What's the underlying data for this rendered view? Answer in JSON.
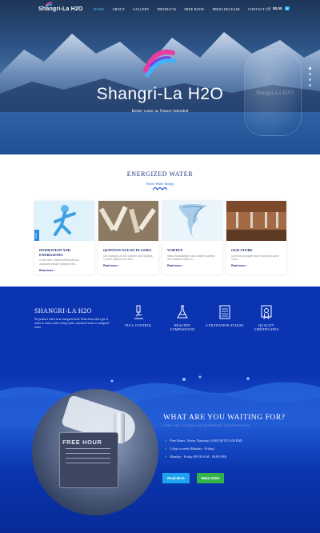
{
  "header": {
    "brand": "Shangri-La H2O",
    "menu": [
      "HOME",
      "ABOUT",
      "GALLERY",
      "PRODUCTS",
      "FREE BOOK",
      "PRESS RELEASE",
      "CONTACT US"
    ],
    "active": "HOME",
    "cart_total": "$0.00",
    "cart_count": "0"
  },
  "hero": {
    "title": "Shangri-La H2O",
    "subtitle": "Better water as Nature intended",
    "bottle_label": "Shangri-La H2O"
  },
  "energized": {
    "title": "ENERGIZED WATER",
    "subtitle": "Vortex Water Energy",
    "cards": [
      {
        "title": "HYDRATION AND ENERGIZING",
        "text": "It has been confirmed that without adequate cellular hydration the...",
        "link": "Read more ›",
        "badge": "SALE"
      },
      {
        "title": "QUINTON OCEAN PLASMA",
        "text": "Our Shangri-La H2O Quinton and Shangri-La H2O Quinton are also...",
        "link": "Read more ›"
      },
      {
        "title": "VORTEX",
        "text": "Viktor Schauberger was a water scientist who studied nature to...",
        "link": "Read more ›"
      },
      {
        "title": "OUR STORE",
        "text": "Come by our water store and drink some of our...",
        "link": "Read more ›"
      }
    ]
  },
  "about": {
    "title": "SHANGRI-LA H2O",
    "text": "We produce water in an energized state. Some know this type of water as vortex water, living water, structured water or energized water.",
    "features": [
      {
        "label": "FULL CONTROL",
        "icon": "microscope-icon"
      },
      {
        "label": "HEALTHY COMPOSITION",
        "icon": "flask-icon"
      },
      {
        "label": "6 FILTRATION STAGES",
        "icon": "filter-icon"
      },
      {
        "label": "QUALITY CERTIFICATES",
        "icon": "certificate-icon"
      }
    ]
  },
  "cta": {
    "sign": "FREE HOUR",
    "title": "WHAT ARE YOU WAITING FOR?",
    "subtitle": "COME VISIT US TODAY AND EXPERIENCE THE DIFFERENCE",
    "schedule": [
      "Free Hours : Every Thursday (3:00 P.M TO 5:00 P.M)",
      "5 days a week (Monday - Friday)",
      "Monday - Friday (09:00 A.M - 04:00 P.M)"
    ],
    "read_more": "Read More",
    "make_order": "Make Order"
  },
  "colors": {
    "accent": "#1ca4f0",
    "green": "#32b44a",
    "navy": "#1d2d74",
    "deep_blue": "#0b34b3"
  }
}
